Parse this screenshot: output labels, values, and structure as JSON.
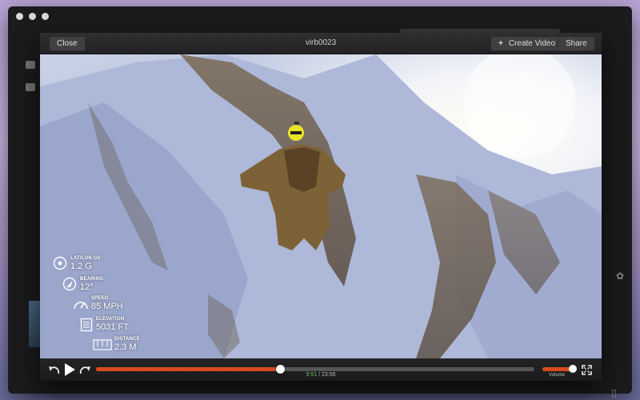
{
  "window": {
    "controls": [
      "close",
      "minimize",
      "zoom"
    ]
  },
  "player": {
    "title": "virb0023",
    "close_label": "Close",
    "create_label": "Create Video",
    "share_label": "Share"
  },
  "overlay": {
    "latlon": {
      "label": "LAT/LON GS",
      "value": "1.2 G",
      "icon": "g-meter-icon"
    },
    "bearing": {
      "label": "BEARING",
      "value": "12°",
      "icon": "compass-arrow-icon"
    },
    "speed": {
      "label": "SPEED",
      "value": "85 MPH",
      "icon": "speedometer-icon"
    },
    "elevation": {
      "label": "ELEVATION",
      "value": "5031 FT",
      "icon": "elevation-icon"
    },
    "distance": {
      "label": "DISTANCE",
      "value": "2.3 M",
      "icon": "distance-icon"
    }
  },
  "controls": {
    "current_time": "9:51",
    "total_time": "23:56",
    "progress": 0.42,
    "volume_label": "Volume",
    "volume": 0.95,
    "accent_color": "#d94a1f"
  }
}
